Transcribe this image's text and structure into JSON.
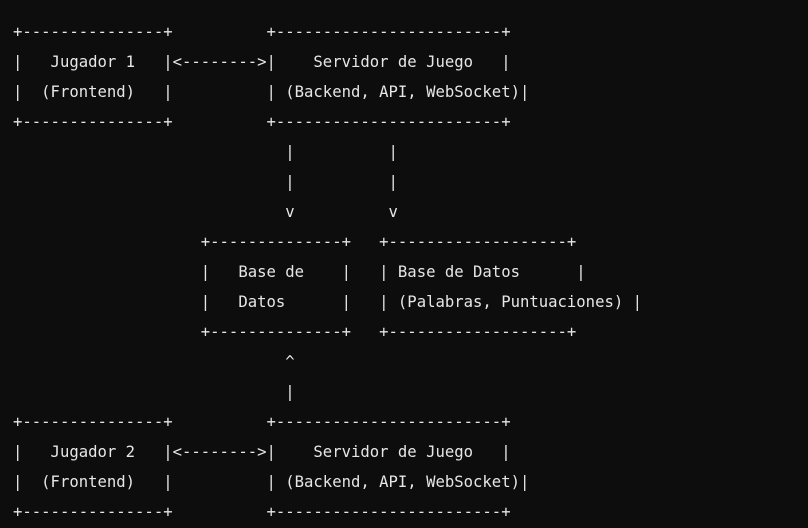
{
  "diagram": {
    "lines": [
      "+---------------+          +------------------------+",
      "|   Jugador 1   |<-------->|    Servidor de Juego   |",
      "|  (Frontend)   |          | (Backend, API, WebSocket)|",
      "+---------------+          +------------------------+",
      "                             |          |",
      "                             |          |",
      "                             v          v",
      "                    +--------------+   +-------------------+",
      "                    |   Base de    |   | Base de Datos      |",
      "                    |   Datos      |   | (Palabras, Puntuaciones) |",
      "                    +--------------+   +-------------------+",
      "                             ^",
      "                             |",
      "+---------------+          +------------------------+",
      "|   Jugador 2   |<-------->|    Servidor de Juego   |",
      "|  (Frontend)   |          | (Backend, API, WebSocket)|",
      "+---------------+          +------------------------+"
    ]
  },
  "colors": {
    "background": "#0d0d0d",
    "text": "#e6e6e6"
  }
}
